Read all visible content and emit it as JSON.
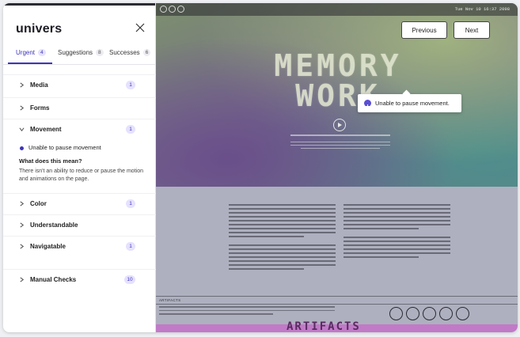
{
  "panel": {
    "brand": "univers",
    "close_icon": "close-icon",
    "tabs": [
      {
        "label": "Urgent",
        "count": "4"
      },
      {
        "label": "Suggestions",
        "count": "8"
      },
      {
        "label": "Successes",
        "count": "6"
      }
    ],
    "sections": [
      {
        "label": "Media",
        "count": "1"
      },
      {
        "label": "Forms",
        "count": ""
      },
      {
        "label": "Movement",
        "count": "1"
      },
      {
        "label": "Color",
        "count": "1"
      },
      {
        "label": "Understandable",
        "count": ""
      },
      {
        "label": "Navigatable",
        "count": "1"
      },
      {
        "label": "Manual Checks",
        "count": "10"
      }
    ],
    "issue": {
      "text": "Unable to pause movement",
      "question": "What does this mean?",
      "answer": "There isn't an ability to reduce or pause the motion and animations on the page."
    },
    "colors": {
      "accent": "#3d34b8",
      "badge_bg": "#e5e1ff"
    }
  },
  "site": {
    "date": "Tue Nov 10 16:37 2098",
    "prev_label": "Previous",
    "next_label": "Next",
    "hero_title_line1": "MEMORY",
    "hero_title_line2": "WORK",
    "tooltip": "Unable to pause movement.",
    "artifacts_label": "ARTIFACTS",
    "footer_title": "ARTIFACTS"
  }
}
